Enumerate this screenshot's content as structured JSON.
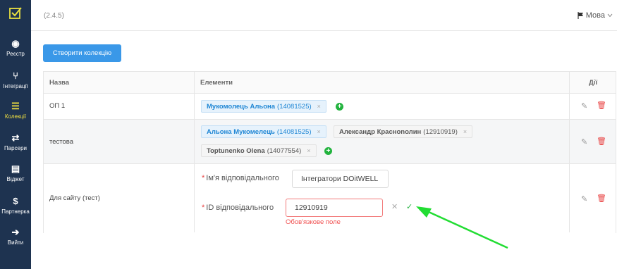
{
  "sidebar": {
    "logo_icon": "check-square-icon",
    "items": [
      {
        "label": "Реєстр",
        "icon": "dashboard-icon",
        "glyph": "◉"
      },
      {
        "label": "Інтеграції",
        "icon": "branch-icon",
        "glyph": "⑂"
      },
      {
        "label": "Колекції",
        "icon": "list-icon",
        "glyph": "☰",
        "active": true
      },
      {
        "label": "Парсери",
        "icon": "arrows-icon",
        "glyph": "⇄"
      },
      {
        "label": "Віджет",
        "icon": "file-code-icon",
        "glyph": "▤"
      },
      {
        "label": "Партнерка",
        "icon": "dollar-icon",
        "glyph": "$"
      },
      {
        "label": "Вийти",
        "icon": "logout-icon",
        "glyph": "➔"
      }
    ]
  },
  "header": {
    "version": "(2.4.5)",
    "language_label": "Мова"
  },
  "create_button": "Створити колекцію",
  "table": {
    "columns": [
      "Назва",
      "Елементи",
      "Дії"
    ],
    "rows": [
      {
        "name": "ОП 1",
        "tags": [
          {
            "name": "Мукомолець Альона",
            "id": "(14081525)"
          }
        ]
      },
      {
        "name": "тестова",
        "tags": [
          {
            "name": "Альона Мукомелець",
            "id": "(14081525)"
          },
          {
            "name": "Александр Красноnолин",
            "id": "(12910919)"
          },
          {
            "name": "Toptunenko Olena",
            "id": "(14077554)"
          }
        ]
      },
      {
        "name": "Для сайту (тест)",
        "form": {
          "name_label": "Ім'я відповідального",
          "name_value": "Інтегратори DOitWELL",
          "id_label": "ID відповідального",
          "id_value": "12910919",
          "error": "Обов'язкове поле"
        }
      }
    ]
  },
  "colors": {
    "sidebar": "#1e3350",
    "accent": "#3a98e8",
    "active": "#f0e040",
    "error": "#f05050",
    "success": "#22b33e",
    "annotation_arrow": "#22dd33"
  }
}
